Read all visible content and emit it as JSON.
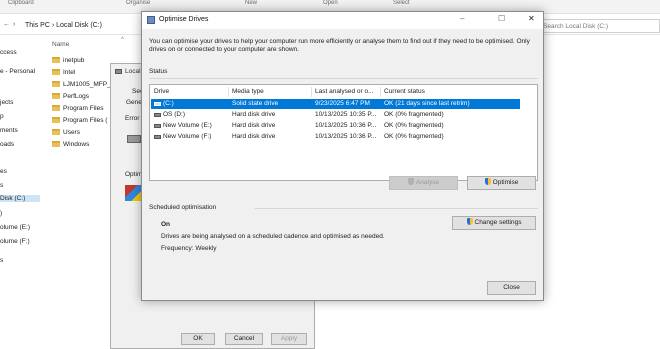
{
  "explorer": {
    "ribbon_labels": [
      "Clipboard",
      "Organise",
      "New",
      "Open",
      "Select"
    ],
    "breadcrumb": "This PC  ›  Local Disk (C:)",
    "search_placeholder": "Search Local Disk (C:)",
    "nav_items": [
      "ccess",
      "e - Personal",
      "jects",
      "p",
      "ments",
      "oads",
      "es",
      "s",
      "Disk (C:)",
      ")",
      "olume (E:)",
      "olume (F:)",
      "s"
    ],
    "column_name": "Name",
    "files": [
      "inetpub",
      "Intel",
      "LJM1005_MFP_",
      "PerfLogs",
      "Program Files",
      "Program Files (",
      "Users",
      "Windows"
    ]
  },
  "props": {
    "title": "Local",
    "tabs": [
      "Secu",
      "Gene"
    ],
    "error_label": "Error c",
    "optimise_label": "Optimi",
    "ok_label": "OK",
    "cancel_label": "Cancel",
    "apply_label": "Apply"
  },
  "dialog": {
    "title": "Optimise Drives",
    "intro": "You can optimise your drives to help your computer run more efficiently or analyse them to find out if they need to be optimised. Only drives on or connected to your computer are shown.",
    "status_label": "Status",
    "columns": [
      "Drive",
      "Media type",
      "Last analysed or o...",
      "Current status"
    ],
    "drives": [
      {
        "drive": "(C:)",
        "media": "Solid state drive",
        "last": "9/23/2025 6:47 PM",
        "status": "OK (21 days since last retrim)"
      },
      {
        "drive": "OS (D:)",
        "media": "Hard disk drive",
        "last": "10/13/2025 10:35 P...",
        "status": "OK (0% fragmented)"
      },
      {
        "drive": "New Volume (E:)",
        "media": "Hard disk drive",
        "last": "10/13/2025 10:36 P...",
        "status": "OK (0% fragmented)"
      },
      {
        "drive": "New Volume (F:)",
        "media": "Hard disk drive",
        "last": "10/13/2025 10:36 P...",
        "status": "OK (0% fragmented)"
      }
    ],
    "analyse_label": "Analyse",
    "optimise_label": "Optimise",
    "scheduled_label": "Scheduled optimisation",
    "schedule_state": "On",
    "schedule_desc": "Drives are being analysed on a scheduled cadence and optimised as needed.",
    "frequency": "Frequency: Weekly",
    "change_settings_label": "Change settings",
    "close_label": "Close",
    "minimize_glyph": "–",
    "maximize_glyph": "☐",
    "close_glyph": "✕"
  },
  "colors": {
    "selection": "#0078d7",
    "nav_selection": "#cce4f7"
  }
}
